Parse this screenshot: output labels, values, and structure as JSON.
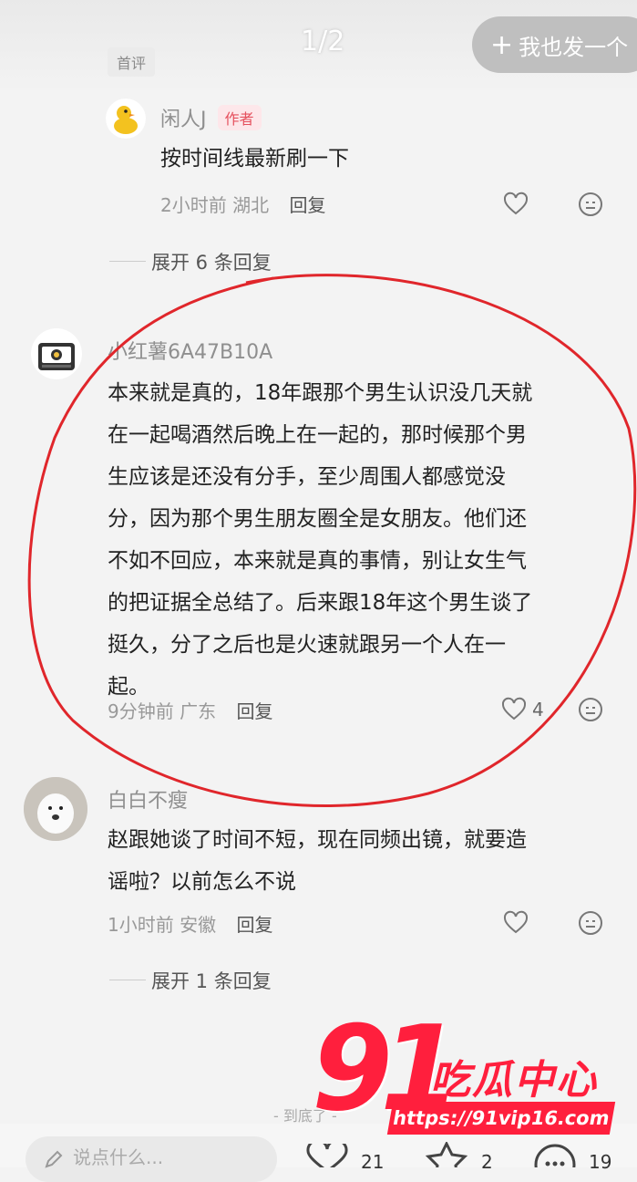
{
  "header": {
    "first_comment_tag": "首评",
    "page_indicator": "1/2",
    "post_button_label": "我也发一个"
  },
  "comments": [
    {
      "user": "闲人J",
      "badge": "作者",
      "text": "按时间线最新刷一下",
      "time": "2小时前",
      "location": "湖北",
      "reply_label": "回复",
      "expand_label": "展开 6 条回复"
    },
    {
      "user": "小红薯6A47B10A",
      "text_lines": [
        "本来就是真的，18年跟那个男生认识没几天就",
        "在一起喝酒然后晚上在一起的，那时候那个男",
        "生应该是还没有分手，至少周围人都感觉没",
        "分，因为那个男生朋友圈全是女朋友。他们还",
        "不如不回应，本来就是真的事情，别让女生气",
        "的把证据全总结了。后来跟18年这个男生谈了",
        "挺久，分了之后也是火速就跟另一个人在一",
        "起。"
      ],
      "time": "9分钟前",
      "location": "广东",
      "reply_label": "回复",
      "likes": "4"
    },
    {
      "user": "白白不瘦",
      "text_lines": [
        "赵跟她谈了时间不短，现在同频出镜，就要造",
        "谣啦？以前怎么不说"
      ],
      "time": "1小时前",
      "location": "安徽",
      "reply_label": "回复",
      "expand_label": "展开 1 条回复"
    }
  ],
  "footer": {
    "end_text": "- 到底了 -",
    "input_placeholder": "说点什么...",
    "like_count": "21",
    "star_count": "2",
    "comment_count": "19"
  },
  "watermark": {
    "number": "91",
    "title": "吃瓜中心",
    "url": "https://91vip16.com"
  },
  "colors": {
    "accent_red": "#ff1f3d",
    "annotation_circle": "#e0262b"
  }
}
